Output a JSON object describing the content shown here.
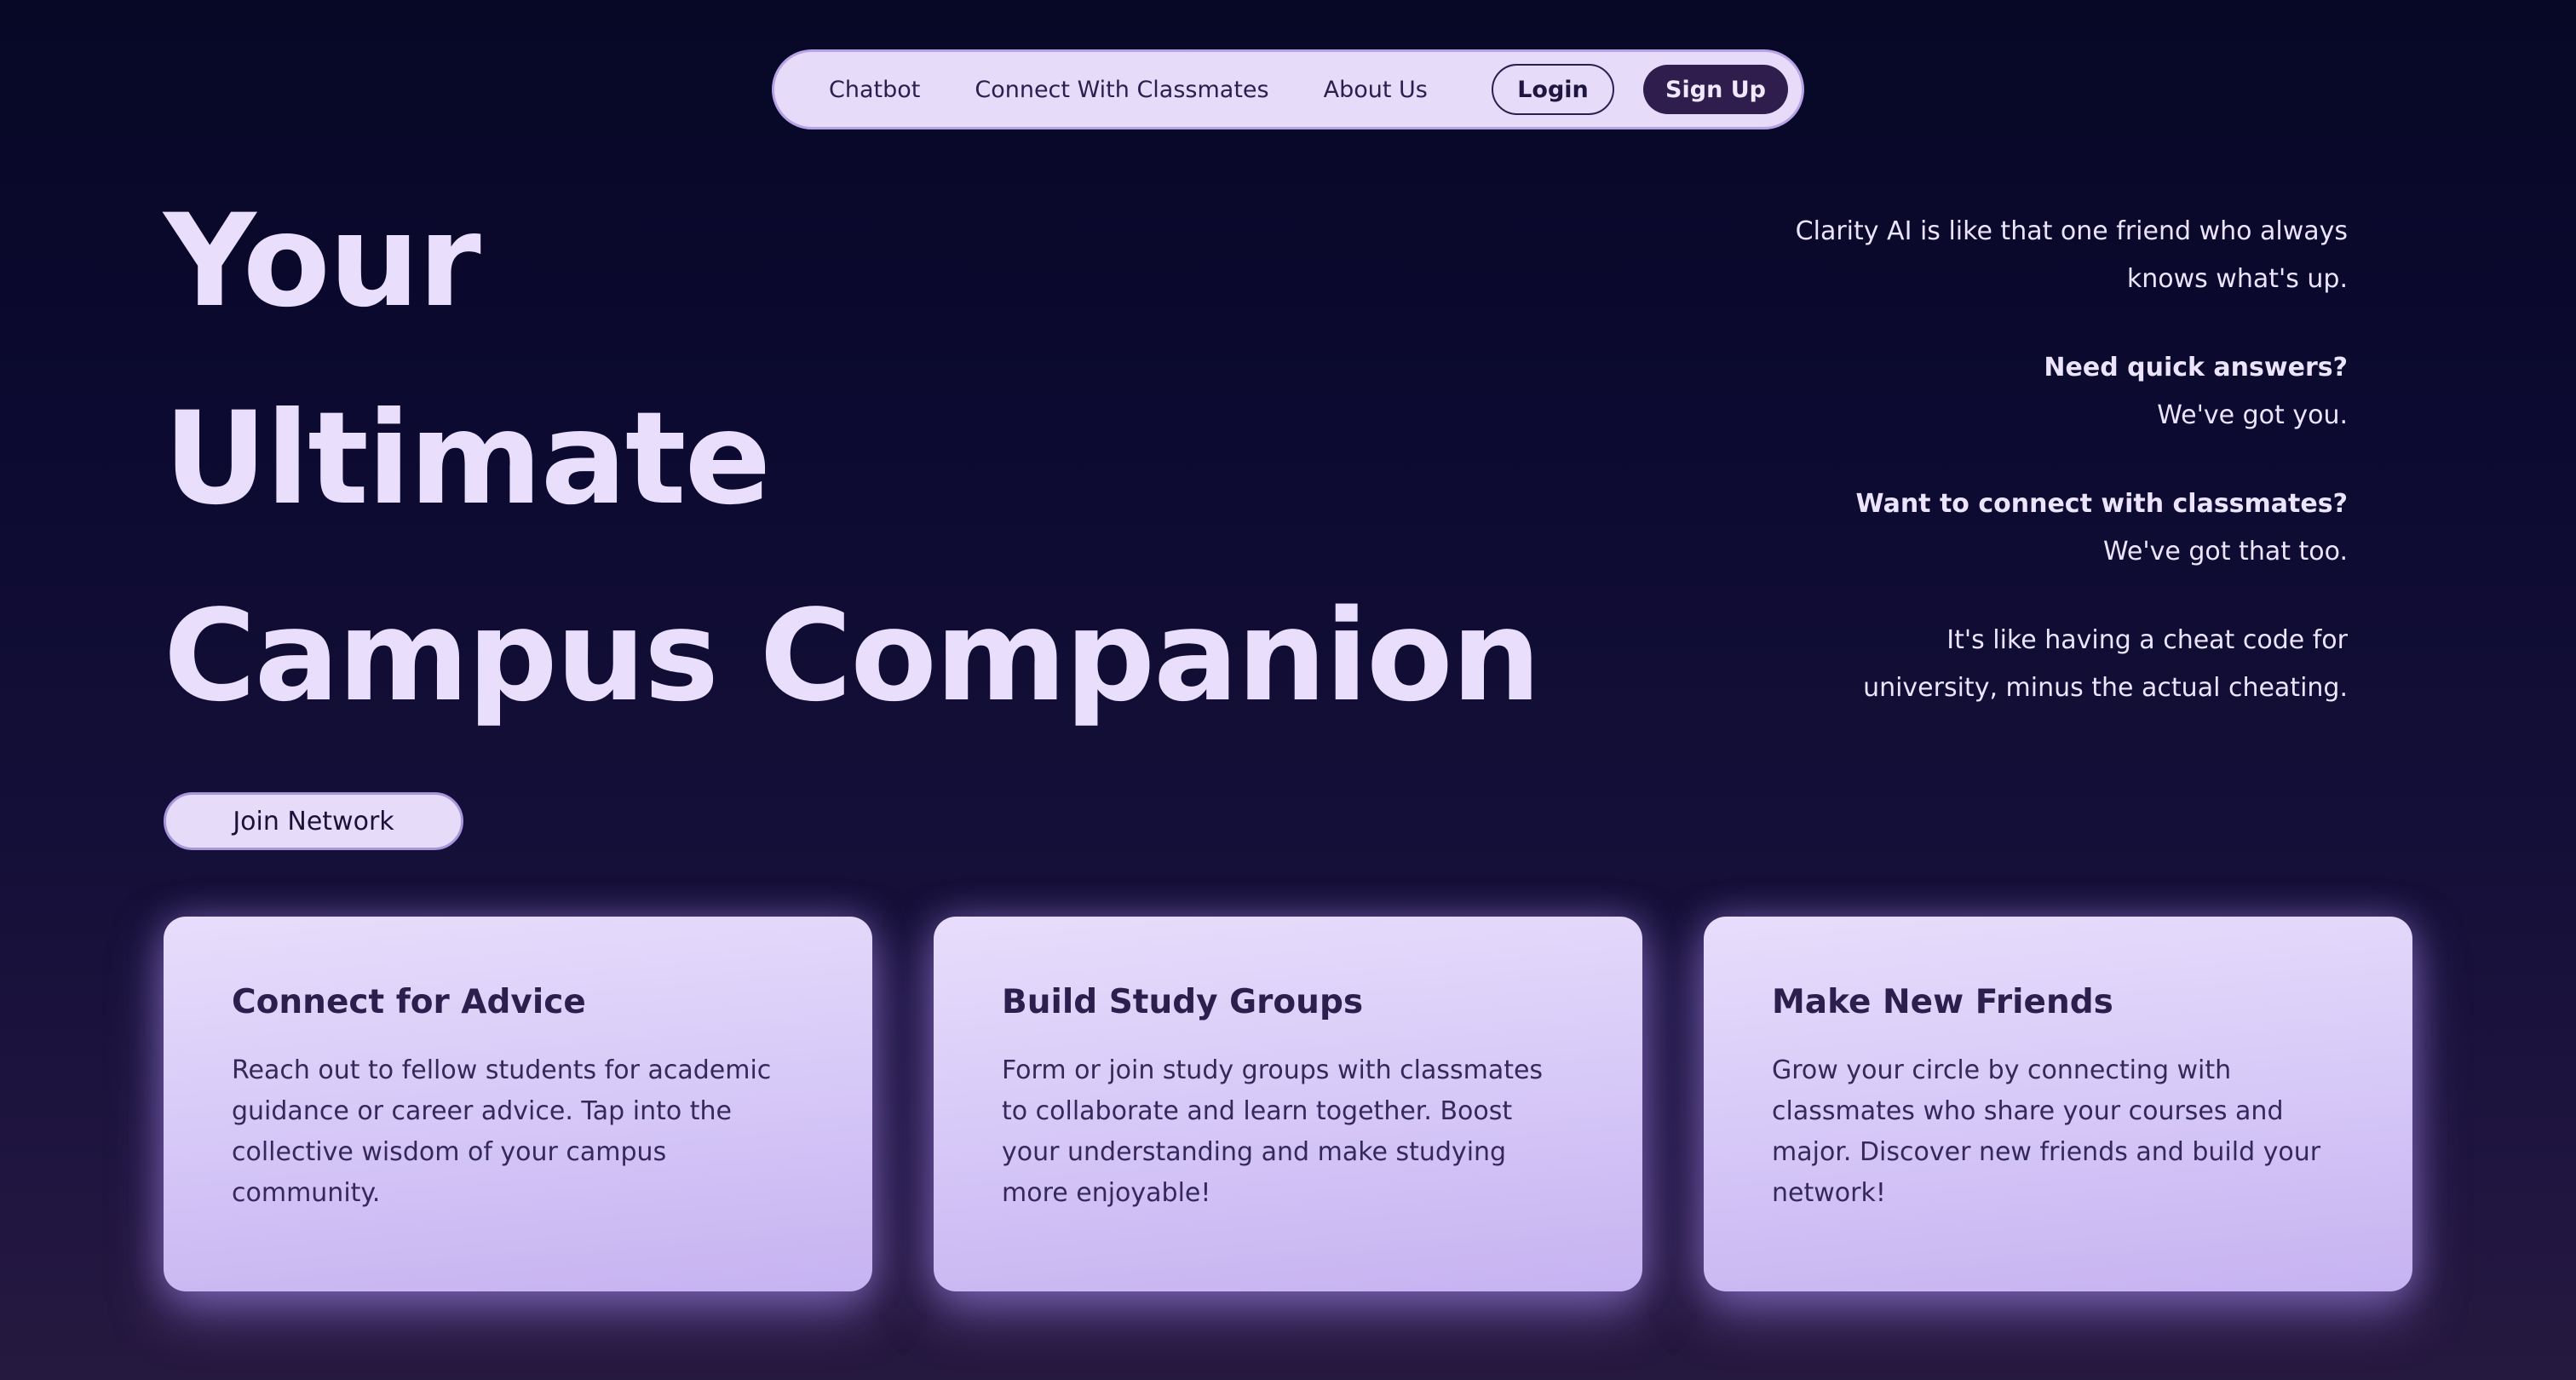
{
  "nav": {
    "links": [
      "Chatbot",
      "Connect With Classmates",
      "About Us"
    ],
    "login_label": "Login",
    "signup_label": "Sign Up"
  },
  "hero": {
    "line1": "Your",
    "line2": "Ultimate",
    "line3": "Campus Companion",
    "cta_label": "Join Network"
  },
  "tagline": {
    "intro_line1": "Clarity AI is like that one friend who always",
    "intro_line2": "knows what's up.",
    "q1": "Need quick answers?",
    "a1": "We've got you.",
    "q2": "Want to connect with classmates?",
    "a2": "We've got that too.",
    "outro_line1": "It's like having a cheat code for",
    "outro_line2": "university, minus the actual cheating."
  },
  "cards": [
    {
      "title": "Connect for Advice",
      "desc": "Reach out to fellow students for academic guidance or career advice. Tap into the collective wisdom of your campus community."
    },
    {
      "title": "Build Study Groups",
      "desc": "Form or join study groups with classmates to collaborate and learn together. Boost your understanding and make studying more enjoyable!"
    },
    {
      "title": "Make New Friends",
      "desc": "Grow your circle by connecting with classmates who share your courses and major. Discover new friends and build your network!"
    }
  ],
  "colors": {
    "background": "#0c0a30",
    "accent_light": "#e6dcf9",
    "accent_dark": "#2f1d4e",
    "card": "#d8cbf8"
  }
}
